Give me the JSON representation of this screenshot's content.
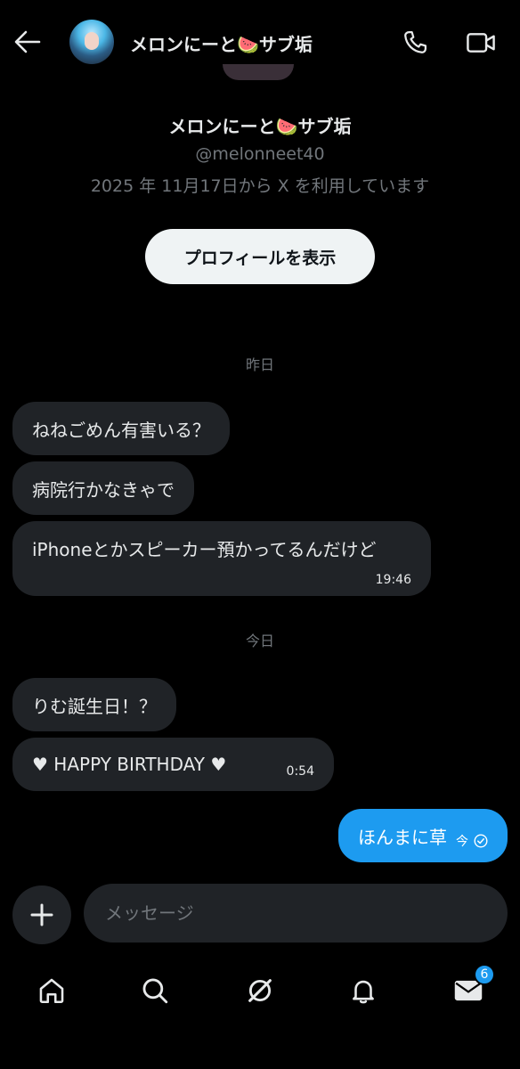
{
  "header": {
    "title": "メロンにーと🍉サブ垢"
  },
  "profile": {
    "name": "メロンにーと🍉サブ垢",
    "handle": "@melonneet40",
    "joined": "2025 年 11月17日から X を利用しています",
    "view_profile_label": "プロフィールを表示"
  },
  "sections": [
    {
      "date": "昨日",
      "messages": [
        {
          "text": "ねねごめん有害いる？"
        },
        {
          "text": "病院行かなきゃで"
        },
        {
          "text": "iPhoneとかスピーカー預かってるんだけど",
          "time": "19:46"
        }
      ]
    },
    {
      "date": "今日",
      "messages": [
        {
          "text": "りむ誕生日！？"
        },
        {
          "text": "♥  HAPPY BIRTHDAY ♥",
          "time": "0:54"
        }
      ]
    }
  ],
  "outgoing": {
    "text": "ほんまに草",
    "time": "今"
  },
  "composer": {
    "placeholder": "メッセージ"
  },
  "tabbar": {
    "messages_badge": "6"
  },
  "colors": {
    "accent": "#1d9bf0",
    "bubble_in": "#202327",
    "muted_text": "#71767b",
    "background": "#000000"
  }
}
